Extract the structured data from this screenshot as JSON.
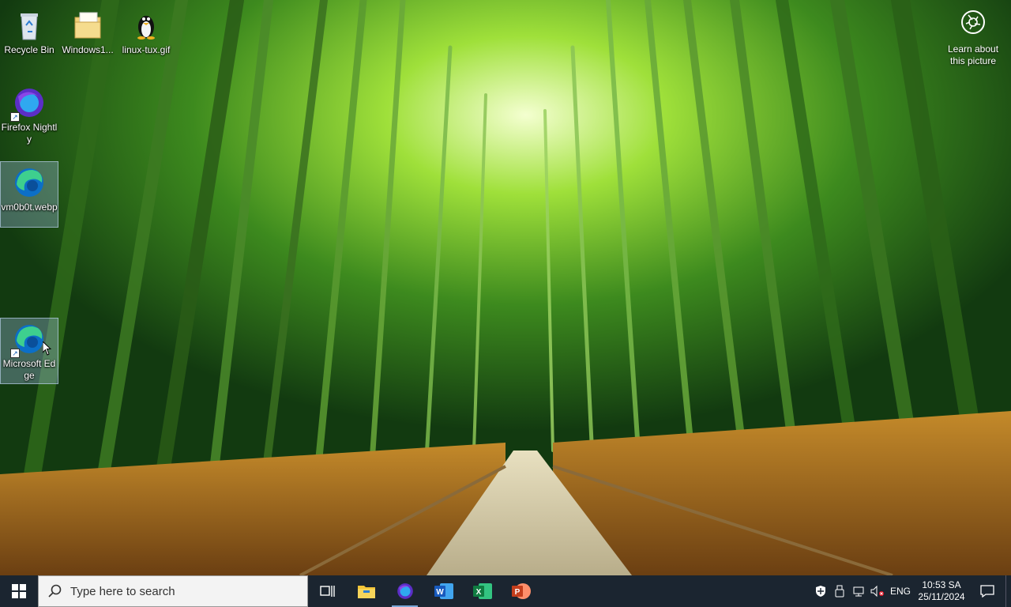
{
  "desktop": {
    "icons": [
      {
        "label": "Recycle Bin",
        "icon": "recycle-bin-icon"
      },
      {
        "label": "Windows1...",
        "icon": "folder-icon"
      },
      {
        "label": "linux-tux.gif",
        "icon": "tux-penguin-icon"
      },
      {
        "label": "Firefox Nightly",
        "icon": "firefox-nightly-icon"
      },
      {
        "label": "vm0b0t.webp",
        "icon": "edge-icon"
      },
      {
        "label": "Microsoft Edge",
        "icon": "edge-icon"
      }
    ],
    "learn_about": {
      "label": "Learn about this picture",
      "icon": "camera-icon"
    }
  },
  "taskbar": {
    "search_placeholder": "Type here to search",
    "apps": [
      {
        "name": "Task View",
        "icon": "task-view-icon"
      },
      {
        "name": "File Explorer",
        "icon": "file-explorer-icon"
      },
      {
        "name": "Firefox Nightly",
        "icon": "firefox-nightly-icon",
        "active": true
      },
      {
        "name": "Word",
        "icon": "word-icon"
      },
      {
        "name": "Excel",
        "icon": "excel-icon"
      },
      {
        "name": "PowerPoint",
        "icon": "powerpoint-icon"
      }
    ],
    "tray": {
      "language": "ENG",
      "time": "10:53 SA",
      "date": "25/11/2024"
    }
  },
  "colors": {
    "taskbar": "#1b2530",
    "search_bg": "#f3f3f3",
    "active_indicator": "#7aa7d8"
  }
}
